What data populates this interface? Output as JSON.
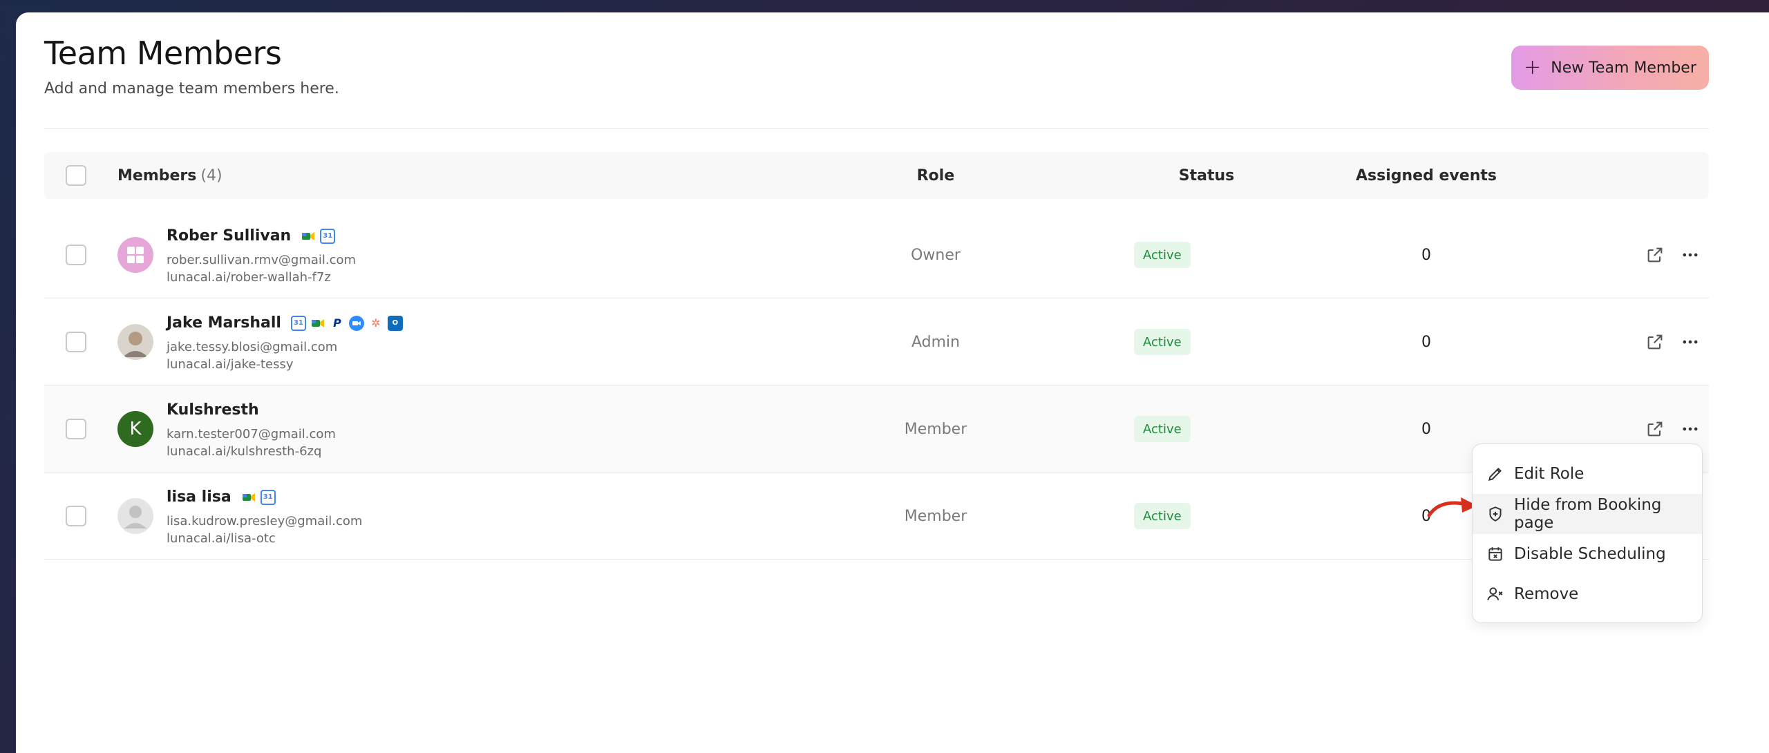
{
  "header": {
    "title": "Team Members",
    "subtitle": "Add and manage team members here.",
    "new_button_label": "New Team Member"
  },
  "table": {
    "columns": {
      "members": "Members",
      "members_count": "(4)",
      "role": "Role",
      "status": "Status",
      "assigned_events": "Assigned events"
    },
    "rows": [
      {
        "name": "Rober Sullivan",
        "email": "rober.sullivan.rmv@gmail.com",
        "link": "lunacal.ai/rober-wallah-f7z",
        "role": "Owner",
        "status": "Active",
        "events": "0",
        "integrations": [
          "google-meet-icon",
          "google-calendar-icon"
        ]
      },
      {
        "name": "Jake Marshall",
        "email": "jake.tessy.blosi@gmail.com",
        "link": "lunacal.ai/jake-tessy",
        "role": "Admin",
        "status": "Active",
        "events": "0",
        "integrations": [
          "google-calendar-icon",
          "google-meet-icon",
          "paypal-icon",
          "zoom-icon",
          "hubspot-icon",
          "outlook-icon"
        ]
      },
      {
        "name": "Kulshresth",
        "email": "karn.tester007@gmail.com",
        "link": "lunacal.ai/kulshresth-6zq",
        "role": "Member",
        "status": "Active",
        "events": "0",
        "avatar_letter": "K",
        "integrations": []
      },
      {
        "name": "lisa lisa",
        "email": "lisa.kudrow.presley@gmail.com",
        "link": "lunacal.ai/lisa-otc",
        "role": "Member",
        "status": "Active",
        "events": "0",
        "integrations": [
          "google-meet-icon",
          "google-calendar-icon"
        ]
      }
    ]
  },
  "context_menu": {
    "items": [
      {
        "label": "Edit Role",
        "icon": "pencil-icon"
      },
      {
        "label": "Hide from Booking page",
        "icon": "shield-icon"
      },
      {
        "label": "Disable Scheduling",
        "icon": "calendar-x-icon"
      },
      {
        "label": "Remove",
        "icon": "user-remove-icon"
      }
    ]
  },
  "colors": {
    "accent_gradient_start": "#e39be6",
    "accent_gradient_end": "#f7b0a6",
    "status_bg": "#e6f7ea",
    "status_text": "#1e8a3c",
    "annotation_arrow": "#d9301e"
  }
}
